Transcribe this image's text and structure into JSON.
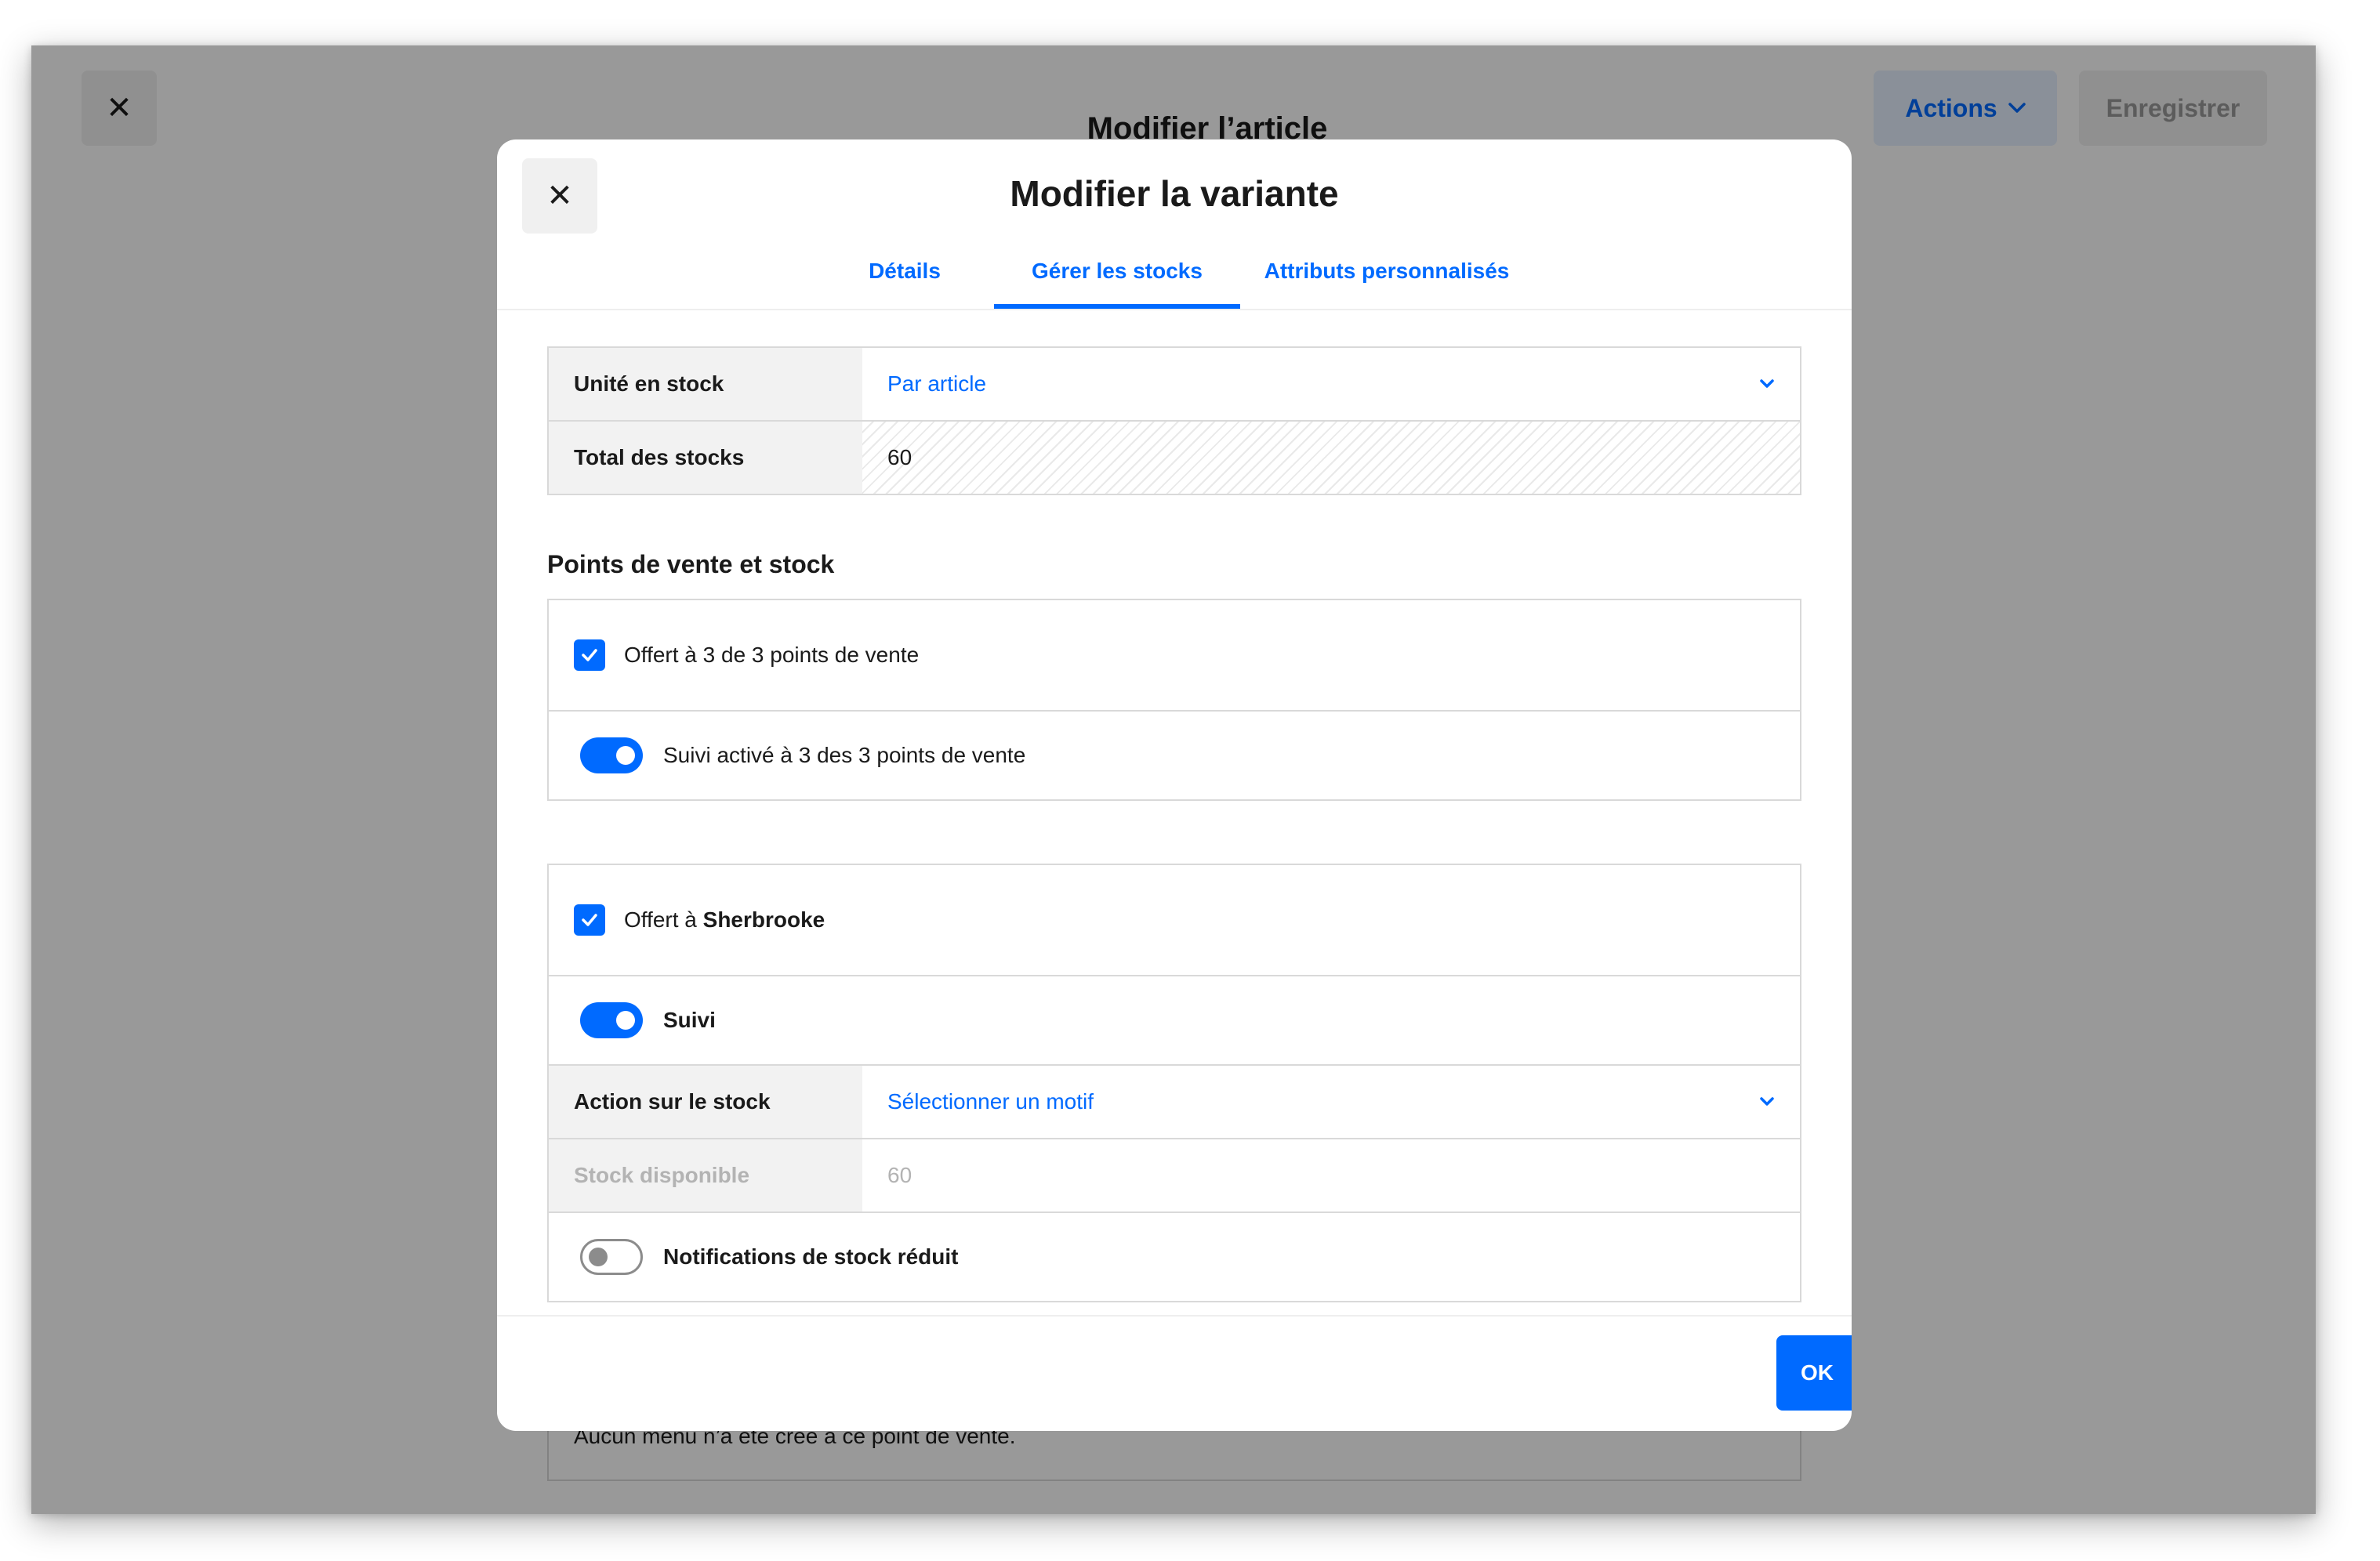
{
  "page": {
    "title": "Modifier l’article",
    "actions_label": "Actions",
    "save_label": "Enregistrer",
    "empty_menu_text": "Aucun menu n’a été créé à ce point de vente."
  },
  "modal": {
    "title": "Modifier la variante",
    "tabs": [
      {
        "label": "Détails",
        "active": false
      },
      {
        "label": "Gérer les stocks",
        "active": true
      },
      {
        "label": "Attributs personnalisés",
        "active": false
      }
    ],
    "stock_table": {
      "unit_label": "Unité en stock",
      "unit_value": "Par article",
      "total_label": "Total des stocks",
      "total_value": "60"
    },
    "section_title": "Points de vente et stock",
    "all_locations": {
      "offered_text": "Offert à 3 de 3 points de vente",
      "offered_checked": true,
      "tracking_text": "Suivi activé à 3 des 3 points de vente",
      "tracking_on": true
    },
    "location": {
      "offered_prefix": "Offert à ",
      "name": "Sherbrooke",
      "offered_checked": true,
      "tracking_label": "Suivi",
      "tracking_on": true,
      "stock_action_label": "Action sur le stock",
      "stock_action_placeholder": "Sélectionner un motif",
      "available_label": "Stock disponible",
      "available_value": "60",
      "low_stock_label": "Notifications de stock réduit",
      "low_stock_on": false
    },
    "ok_label": "OK"
  },
  "colors": {
    "accent": "#006aff",
    "overlay": "rgba(0,0,0,0.40)",
    "border": "#d9d9d9",
    "label_bg": "#f2f2f2"
  },
  "icons": {
    "close": "close-icon",
    "chevron": "chevron-down-icon",
    "check": "check-icon"
  }
}
